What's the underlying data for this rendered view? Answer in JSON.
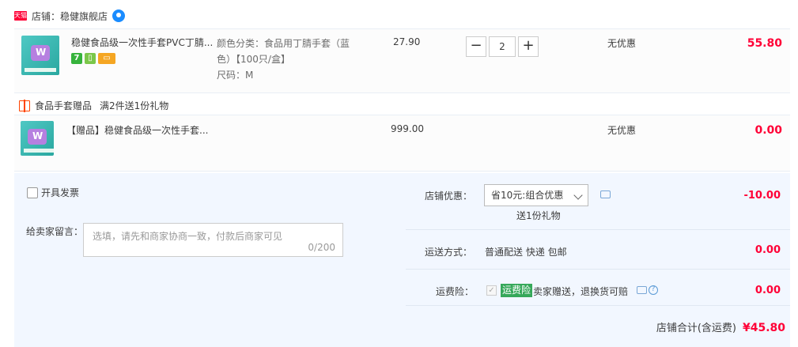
{
  "shop": {
    "badge": "天猫",
    "name": "店铺：稳健旗舰店"
  },
  "items": [
    {
      "title": "稳健食品级一次性手套PVC丁腈...",
      "sku_line1": "颜色分类：食品用丁腈手套（蓝",
      "sku_line2": "色）【100只/盒】",
      "sku_line3": "尺码：M",
      "price": "27.90",
      "quantity": "2",
      "discount": "无优惠",
      "total": "55.80",
      "badges": [
        "7",
        "phone-icon",
        "card-icon"
      ]
    }
  ],
  "gift_promo": {
    "category": "食品手套赠品",
    "rule": "满2件送1份礼物",
    "item": {
      "title": "【赠品】稳健食品级一次性手套...",
      "price": "999.00",
      "discount": "无优惠",
      "total": "0.00"
    }
  },
  "order": {
    "invoice_label": "开具发票",
    "message_label": "给卖家留言：",
    "message_placeholder": "选填，请先和商家协商一致，付款后商家可见",
    "message_count": "0/200",
    "shop_discount_label": "店铺优惠：",
    "shop_discount_selected": "省10元:组合优惠",
    "shop_discount_gift": "送1份礼物",
    "shop_discount_value": "-10.00",
    "shipping_label": "运送方式：",
    "shipping_method": "普通配送 快递 包邮",
    "shipping_value": "0.00",
    "insurance_label": "运费险：",
    "insurance_tag": "运费险",
    "insurance_text": "卖家赠送，退换货可赔",
    "insurance_value": "0.00",
    "total_label": "店铺合计(含运费)",
    "total_value": "¥45.80"
  }
}
